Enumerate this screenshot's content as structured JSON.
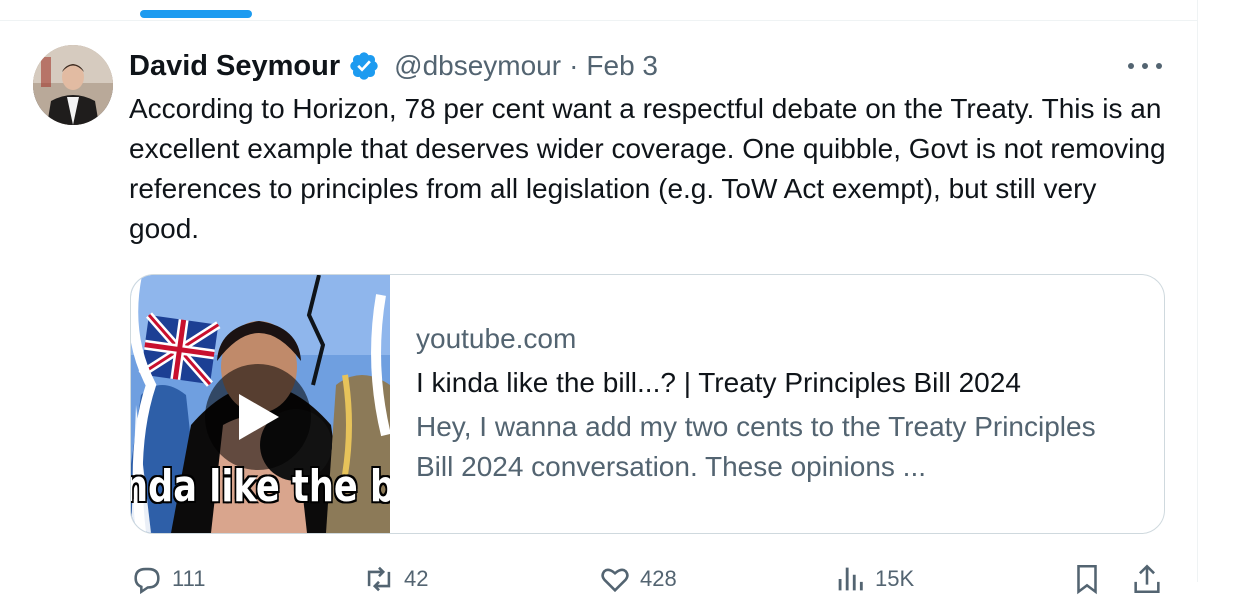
{
  "tweet": {
    "author_name": "David Seymour",
    "handle": "@dbseymour",
    "separator": "·",
    "date": "Feb 3",
    "text": "According to Horizon, 78 per cent want a respectful debate on the Treaty. This is an excellent example that deserves wider coverage. One quibble, Govt is not removing references to principles from all legislation (e.g. ToW Act exempt), but still very good."
  },
  "card": {
    "domain": "youtube.com",
    "title": "I kinda like the bill...? | Treaty Principles Bill 2024",
    "description": "Hey, I wanna add my two cents to the Treaty Principles Bill 2024 conversation. These opinions ...",
    "thumbnail_caption": "nda like the bi"
  },
  "actions": {
    "replies": "111",
    "reposts": "42",
    "likes": "428",
    "views": "15K"
  },
  "colors": {
    "accent": "#1d9bf0",
    "text_primary": "#0f1419",
    "text_secondary": "#536471",
    "border": "#cfd9de"
  },
  "icons": [
    "verified-badge-icon",
    "more-icon",
    "play-icon",
    "reply-icon",
    "repost-icon",
    "like-icon",
    "views-icon",
    "bookmark-icon",
    "share-icon"
  ]
}
